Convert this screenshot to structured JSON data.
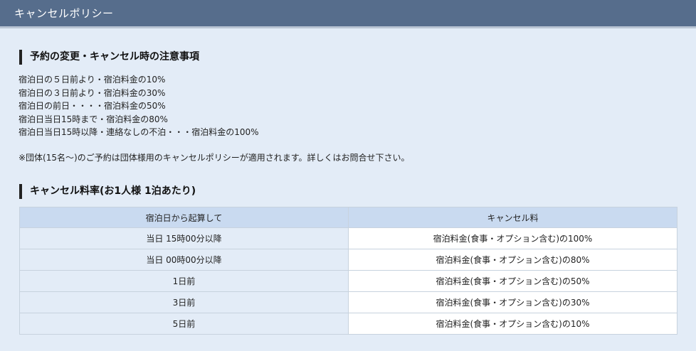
{
  "header": {
    "title": "キャンセルポリシー"
  },
  "section1": {
    "heading": "予約の変更・キャンセル時の注意事項",
    "lines": [
      "宿泊日の５日前より・宿泊料金の10%",
      "宿泊日の３日前より・宿泊料金の30%",
      "宿泊日の前日・・・・宿泊料金の50%",
      "宿泊日当日15時まで・宿泊料金の80%",
      "宿泊日当日15時以降・連絡なしの不泊・・・宿泊料金の100%"
    ],
    "group_note": "※団体(15名～)のご予約は団体様用のキャンセルポリシーが適用されます。詳しくはお問合せ下さい。"
  },
  "section2": {
    "heading": "キャンセル料率(お1人様 1泊あたり)",
    "table": {
      "headers": [
        "宿泊日から起算して",
        "キャンセル料"
      ],
      "rows": [
        [
          "当日 15時00分以降",
          "宿泊料金(食事・オプション含む)の100%"
        ],
        [
          "当日 00時00分以降",
          "宿泊料金(食事・オプション含む)の80%"
        ],
        [
          "1日前",
          "宿泊料金(食事・オプション含む)の50%"
        ],
        [
          "3日前",
          "宿泊料金(食事・オプション含む)の30%"
        ],
        [
          "5日前",
          "宿泊料金(食事・オプション含む)の10%"
        ]
      ]
    }
  }
}
